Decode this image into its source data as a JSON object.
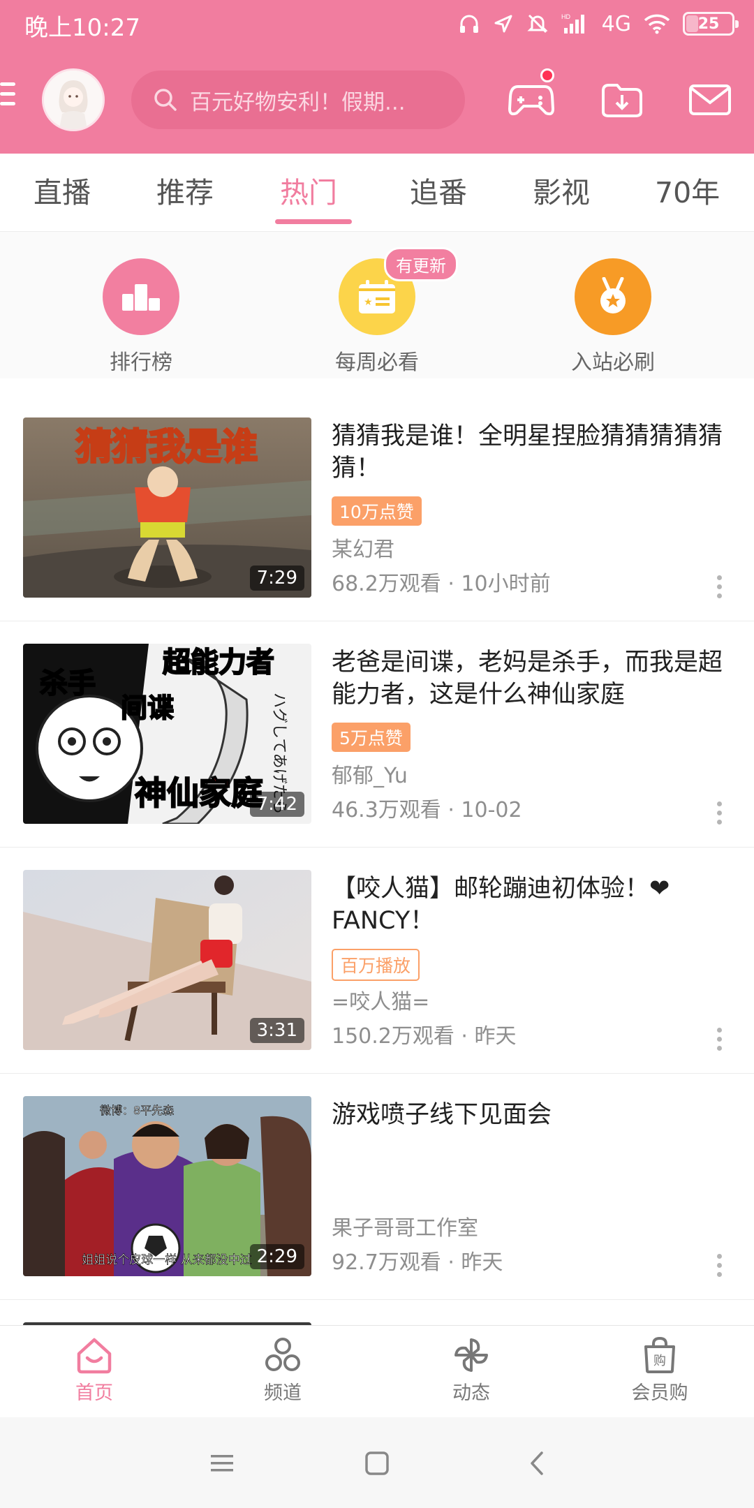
{
  "status_bar": {
    "time": "晚上10:27",
    "network": "4G",
    "battery": "25",
    "battery_fraction": 0.25,
    "icons": [
      "headphones-icon",
      "location-icon",
      "mute-icon",
      "signal-icon",
      "wifi-icon",
      "battery-icon"
    ]
  },
  "header": {
    "search_placeholder": "百元好物安利！假期...",
    "icons": [
      "menu-icon",
      "avatar",
      "search-icon",
      "game-icon",
      "download-icon",
      "mail-icon"
    ]
  },
  "tabs": [
    {
      "label": "直播",
      "active": false
    },
    {
      "label": "推荐",
      "active": false
    },
    {
      "label": "热门",
      "active": true
    },
    {
      "label": "追番",
      "active": false
    },
    {
      "label": "影视",
      "active": false
    },
    {
      "label": "70年",
      "active": false
    }
  ],
  "quick_entries": [
    {
      "label": "排行榜",
      "icon": "ranking-icon",
      "color": "#f27fa0"
    },
    {
      "label": "每周必看",
      "icon": "calendar-icon",
      "color": "#fcd44a",
      "badge": "有更新"
    },
    {
      "label": "入站必刷",
      "icon": "medal-icon",
      "color": "#f79b26"
    }
  ],
  "videos": [
    {
      "title": "猜猜我是谁！全明星捏脸猜猜猜猜猜猜！",
      "tag": "10万点赞",
      "author": "某幻君",
      "meta": "68.2万观看 · 10小时前",
      "duration": "7:29",
      "thumb_text": "猜猜我是谁"
    },
    {
      "title": "老爸是间谍，老妈是杀手，而我是超能力者，这是什么神仙家庭",
      "tag": "5万点赞",
      "author": "郁郁_Yu",
      "meta": "46.3万观看 · 10-02",
      "duration": "7:42",
      "thumb_text": {
        "t1": "杀手",
        "t2": "超能力者",
        "t3": "间谍",
        "t4": "神仙家庭"
      }
    },
    {
      "title": "【咬人猫】邮轮蹦迪初体验！❤ FANCY！",
      "tag": "百万播放",
      "author": "=咬人猫=",
      "meta": "150.2万观看 · 昨天",
      "duration": "3:31"
    },
    {
      "title": "游戏喷子线下见面会",
      "tag": "",
      "author": "果子哥哥工作室",
      "meta": "92.7万观看 · 昨天",
      "duration": "2:29",
      "thumb_text": {
        "top": "微博：8平先森",
        "caption": "姐姐说个皮球一样 从来都没中过"
      }
    }
  ],
  "bottom_nav": [
    {
      "label": "首页",
      "icon": "home-icon",
      "active": true
    },
    {
      "label": "频道",
      "icon": "channel-icon",
      "active": false
    },
    {
      "label": "动态",
      "icon": "pinwheel-icon",
      "active": false
    },
    {
      "label": "会员购",
      "icon": "shopping-bag-icon",
      "active": false
    }
  ],
  "colors": {
    "brand_pink": "#f17d9f",
    "tag_orange": "#fba068",
    "text_primary": "#212121",
    "text_secondary": "#8e8e8e"
  }
}
